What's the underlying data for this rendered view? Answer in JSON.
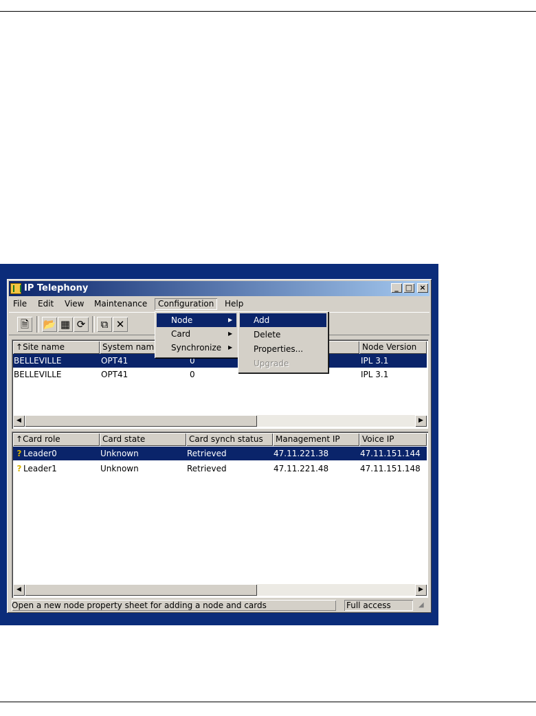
{
  "window": {
    "title": "IP Telephony",
    "controls": [
      "_",
      "□",
      "×"
    ]
  },
  "menubar": [
    "File",
    "Edit",
    "View",
    "Maintenance",
    "Configuration",
    "Help"
  ],
  "config_menu": [
    {
      "label": "Node",
      "submenu": true
    },
    {
      "label": "Card",
      "submenu": true
    },
    {
      "label": "Synchronize",
      "submenu": true
    }
  ],
  "node_submenu": [
    {
      "label": "Add"
    },
    {
      "label": "Delete"
    },
    {
      "label": "Properties..."
    },
    {
      "label": "Upgrade"
    }
  ],
  "toolbar": {
    "icons": [
      "new-sheet-icon",
      "open-folder-icon",
      "grid-view-icon",
      "sync-icon",
      "copy-icon",
      "delete-icon"
    ],
    "glyphs": [
      "🗎",
      "📂",
      "▦",
      "⟳",
      "⧉",
      "✕"
    ]
  },
  "nodes_table": {
    "columns": [
      "Site name",
      "System name",
      "",
      "",
      "Node Version"
    ],
    "rows": [
      {
        "cells": [
          "BELLEVILLE",
          "OPT41",
          "0",
          "",
          "IPL 3.1"
        ],
        "selected": true
      },
      {
        "cells": [
          "BELLEVILLE",
          "OPT41",
          "0",
          "",
          "IPL 3.1"
        ],
        "selected": false
      }
    ]
  },
  "cards_table": {
    "columns": [
      "Card role",
      "Card state",
      "Card synch status",
      "Management IP",
      "Voice IP"
    ],
    "rows": [
      {
        "cells": [
          "Leader0",
          "Unknown",
          "Retrieved",
          "47.11.221.38",
          "47.11.151.144"
        ],
        "selected": true
      },
      {
        "cells": [
          "Leader1",
          "Unknown",
          "Retrieved",
          "47.11.221.48",
          "47.11.151.148"
        ],
        "selected": false
      }
    ]
  },
  "statusbar": {
    "message": "Open a new node property sheet for adding a node and cards",
    "access": "Full access"
  }
}
